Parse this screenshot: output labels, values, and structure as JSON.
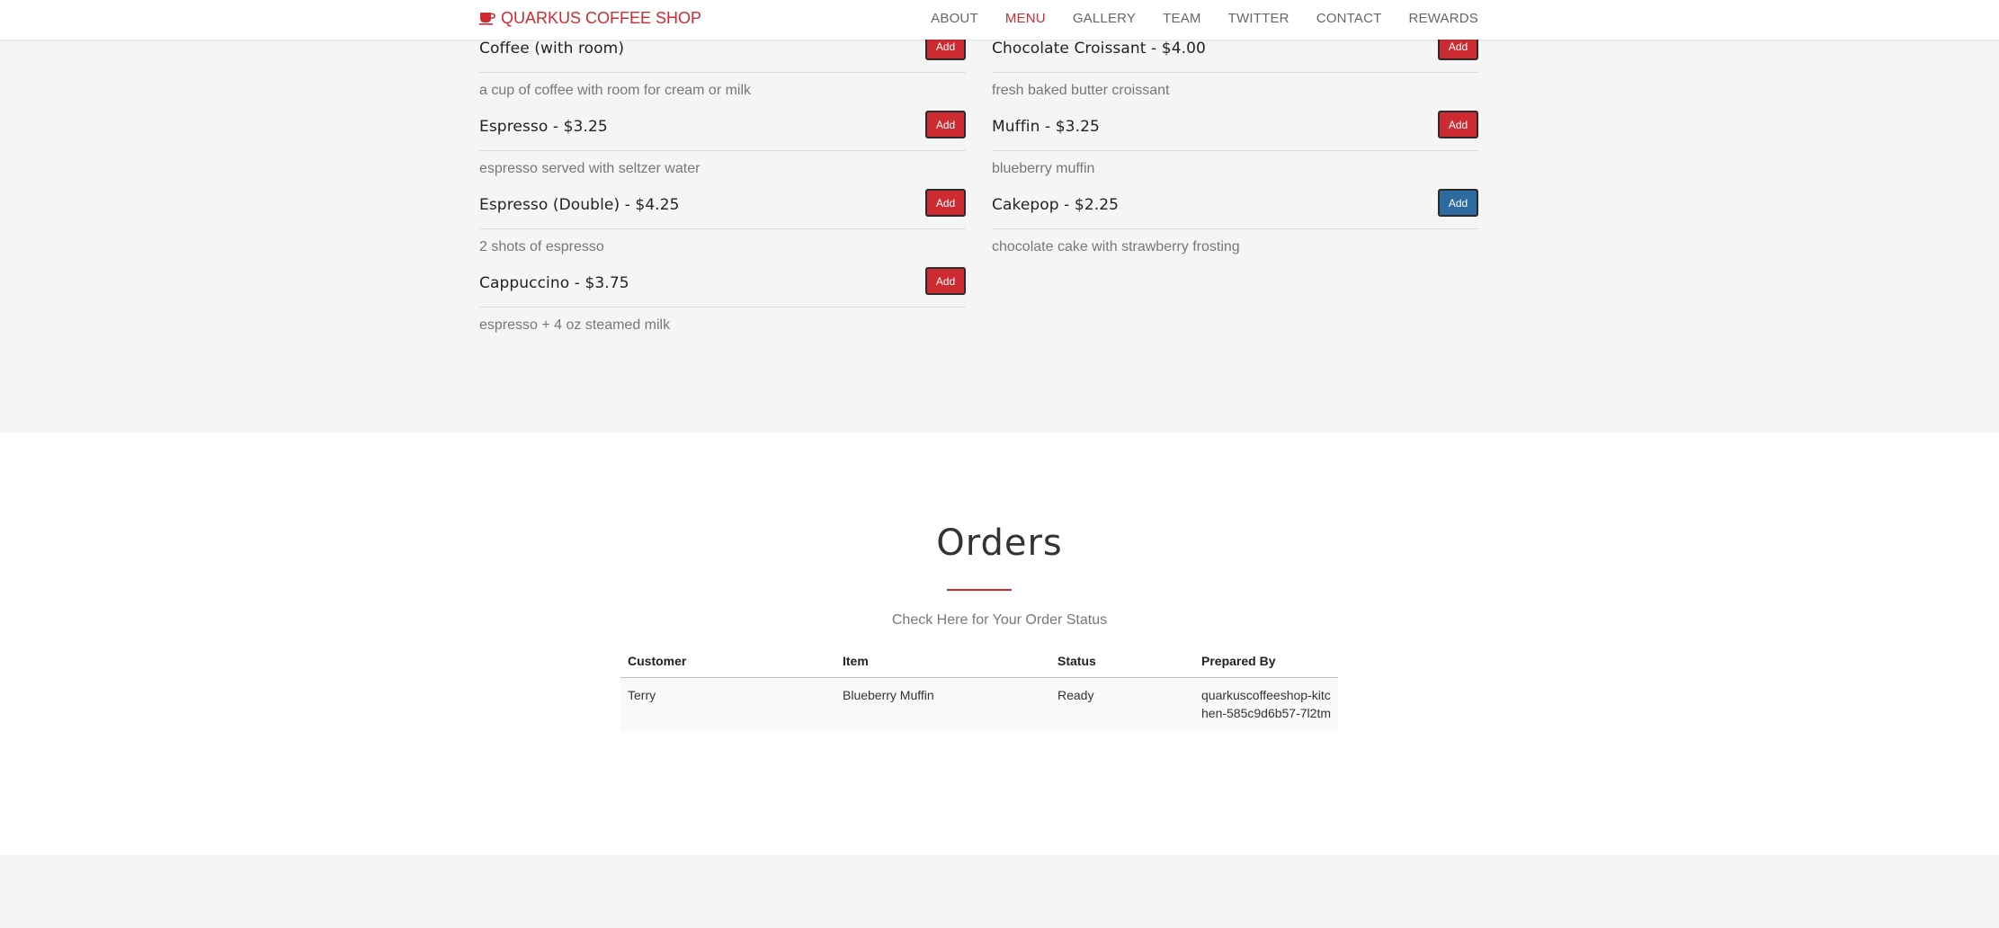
{
  "brand": {
    "name": "QUARKUS COFFEE SHOP",
    "icon": "coffee-cup-icon",
    "color": "#cd2b31"
  },
  "nav": [
    {
      "label": "ABOUT",
      "active": false
    },
    {
      "label": "MENU",
      "active": true
    },
    {
      "label": "GALLERY",
      "active": false
    },
    {
      "label": "TEAM",
      "active": false
    },
    {
      "label": "TWITTER",
      "active": false
    },
    {
      "label": "CONTACT",
      "active": false
    },
    {
      "label": "REWARDS",
      "active": false
    }
  ],
  "menu": {
    "left": [
      {
        "title": "Coffee (with room)",
        "description": "a cup of coffee with room for cream or milk",
        "button": "Add"
      },
      {
        "title": "Espresso - $3.25",
        "description": "espresso served with seltzer water",
        "button": "Add"
      },
      {
        "title": "Espresso (Double) - $4.25",
        "description": "2 shots of espresso",
        "button": "Add"
      },
      {
        "title": "Cappuccino - $3.75",
        "description": "espresso + 4 oz steamed milk",
        "button": "Add"
      }
    ],
    "right": [
      {
        "title": "Chocolate Croissant - $4.00",
        "description": "fresh baked butter croissant",
        "button": "Add"
      },
      {
        "title": "Muffin - $3.25",
        "description": "blueberry muffin",
        "button": "Add"
      },
      {
        "title": "Cakepop - $2.25",
        "description": "chocolate cake with strawberry frosting",
        "button": "Add",
        "focused": true
      }
    ]
  },
  "orders": {
    "title": "Orders",
    "subtitle": "Check Here for Your Order Status",
    "columns": [
      "Customer",
      "Item",
      "Status",
      "Prepared By"
    ],
    "rows": [
      {
        "customer": "Terry",
        "item": "Blueberry Muffin",
        "status": "Ready",
        "prepared_by": "quarkuscoffeeshop-kitchen-585c9d6b57-7l2tm"
      }
    ]
  },
  "colors": {
    "accent": "#cd2b31",
    "focused_button": "#2d6a9f"
  }
}
